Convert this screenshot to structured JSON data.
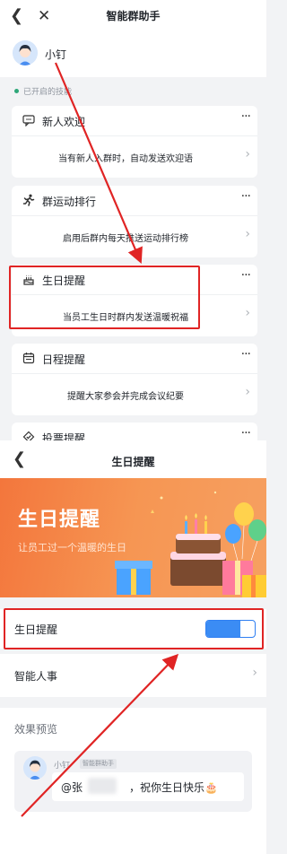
{
  "screen1": {
    "nav": {
      "title": "智能群助手",
      "back_icon": "chevron-left-icon",
      "close_icon": "close-icon"
    },
    "bot": {
      "name": "小钉"
    },
    "section": {
      "label": "已开启的技能"
    },
    "cards": [
      {
        "title": "新人欢迎",
        "icon": "chat-icon",
        "desc": "当有新人入群时，自动发送欢迎语"
      },
      {
        "title": "群运动排行",
        "icon": "running-icon",
        "desc": "启用后群内每天推送运动排行榜"
      },
      {
        "title": "生日提醒",
        "icon": "cake-icon",
        "desc": "当员工生日时群内发送温暖祝福"
      },
      {
        "title": "日程提醒",
        "icon": "calendar-icon",
        "desc": "提醒大家参会并完成会议纪要"
      },
      {
        "title": "投票提醒",
        "icon": "vote-icon",
        "desc": ""
      }
    ],
    "more_label": "···"
  },
  "screen2": {
    "nav": {
      "title": "生日提醒",
      "back_icon": "chevron-left-icon"
    },
    "banner": {
      "title": "生日提醒",
      "subtitle": "让员工过一个温暖的生日"
    },
    "toggle_row": {
      "label": "生日提醒",
      "enabled": true
    },
    "hr_row": {
      "label": "智能人事"
    },
    "preview": {
      "title": "效果预览",
      "sender": "小钉",
      "tag": "智能群助手",
      "mention": "@张",
      "message": "，祝你生日快乐🎂"
    }
  },
  "colors": {
    "accent": "#3b8cf4",
    "banner": "#f3763c",
    "highlight": "#e02424",
    "bg": "#f2f3f5"
  }
}
